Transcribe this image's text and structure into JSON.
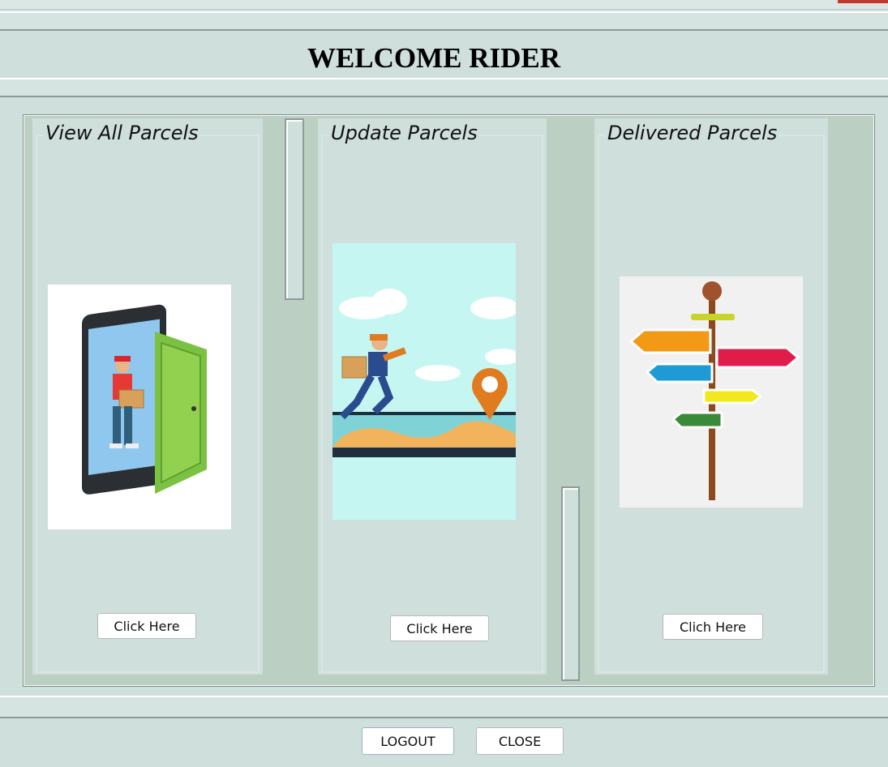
{
  "header": {
    "title": "WELCOME RIDER"
  },
  "panels": [
    {
      "title": "View All Parcels",
      "button": "Click Here",
      "image": "delivery-man-phone-door-illustration"
    },
    {
      "title": "Update Parcels",
      "button": "Click Here",
      "image": "courier-running-to-map-pin-illustration"
    },
    {
      "title": "Delivered Parcels",
      "button": "Clich Here",
      "image": "signpost-arrows-illustration"
    }
  ],
  "footer": {
    "logout_label": "LOGOUT",
    "close_label": "CLOSE"
  },
  "colors": {
    "background": "#cfdfdc",
    "frame": "#bccfc3",
    "accent_red": "#c0392b"
  }
}
